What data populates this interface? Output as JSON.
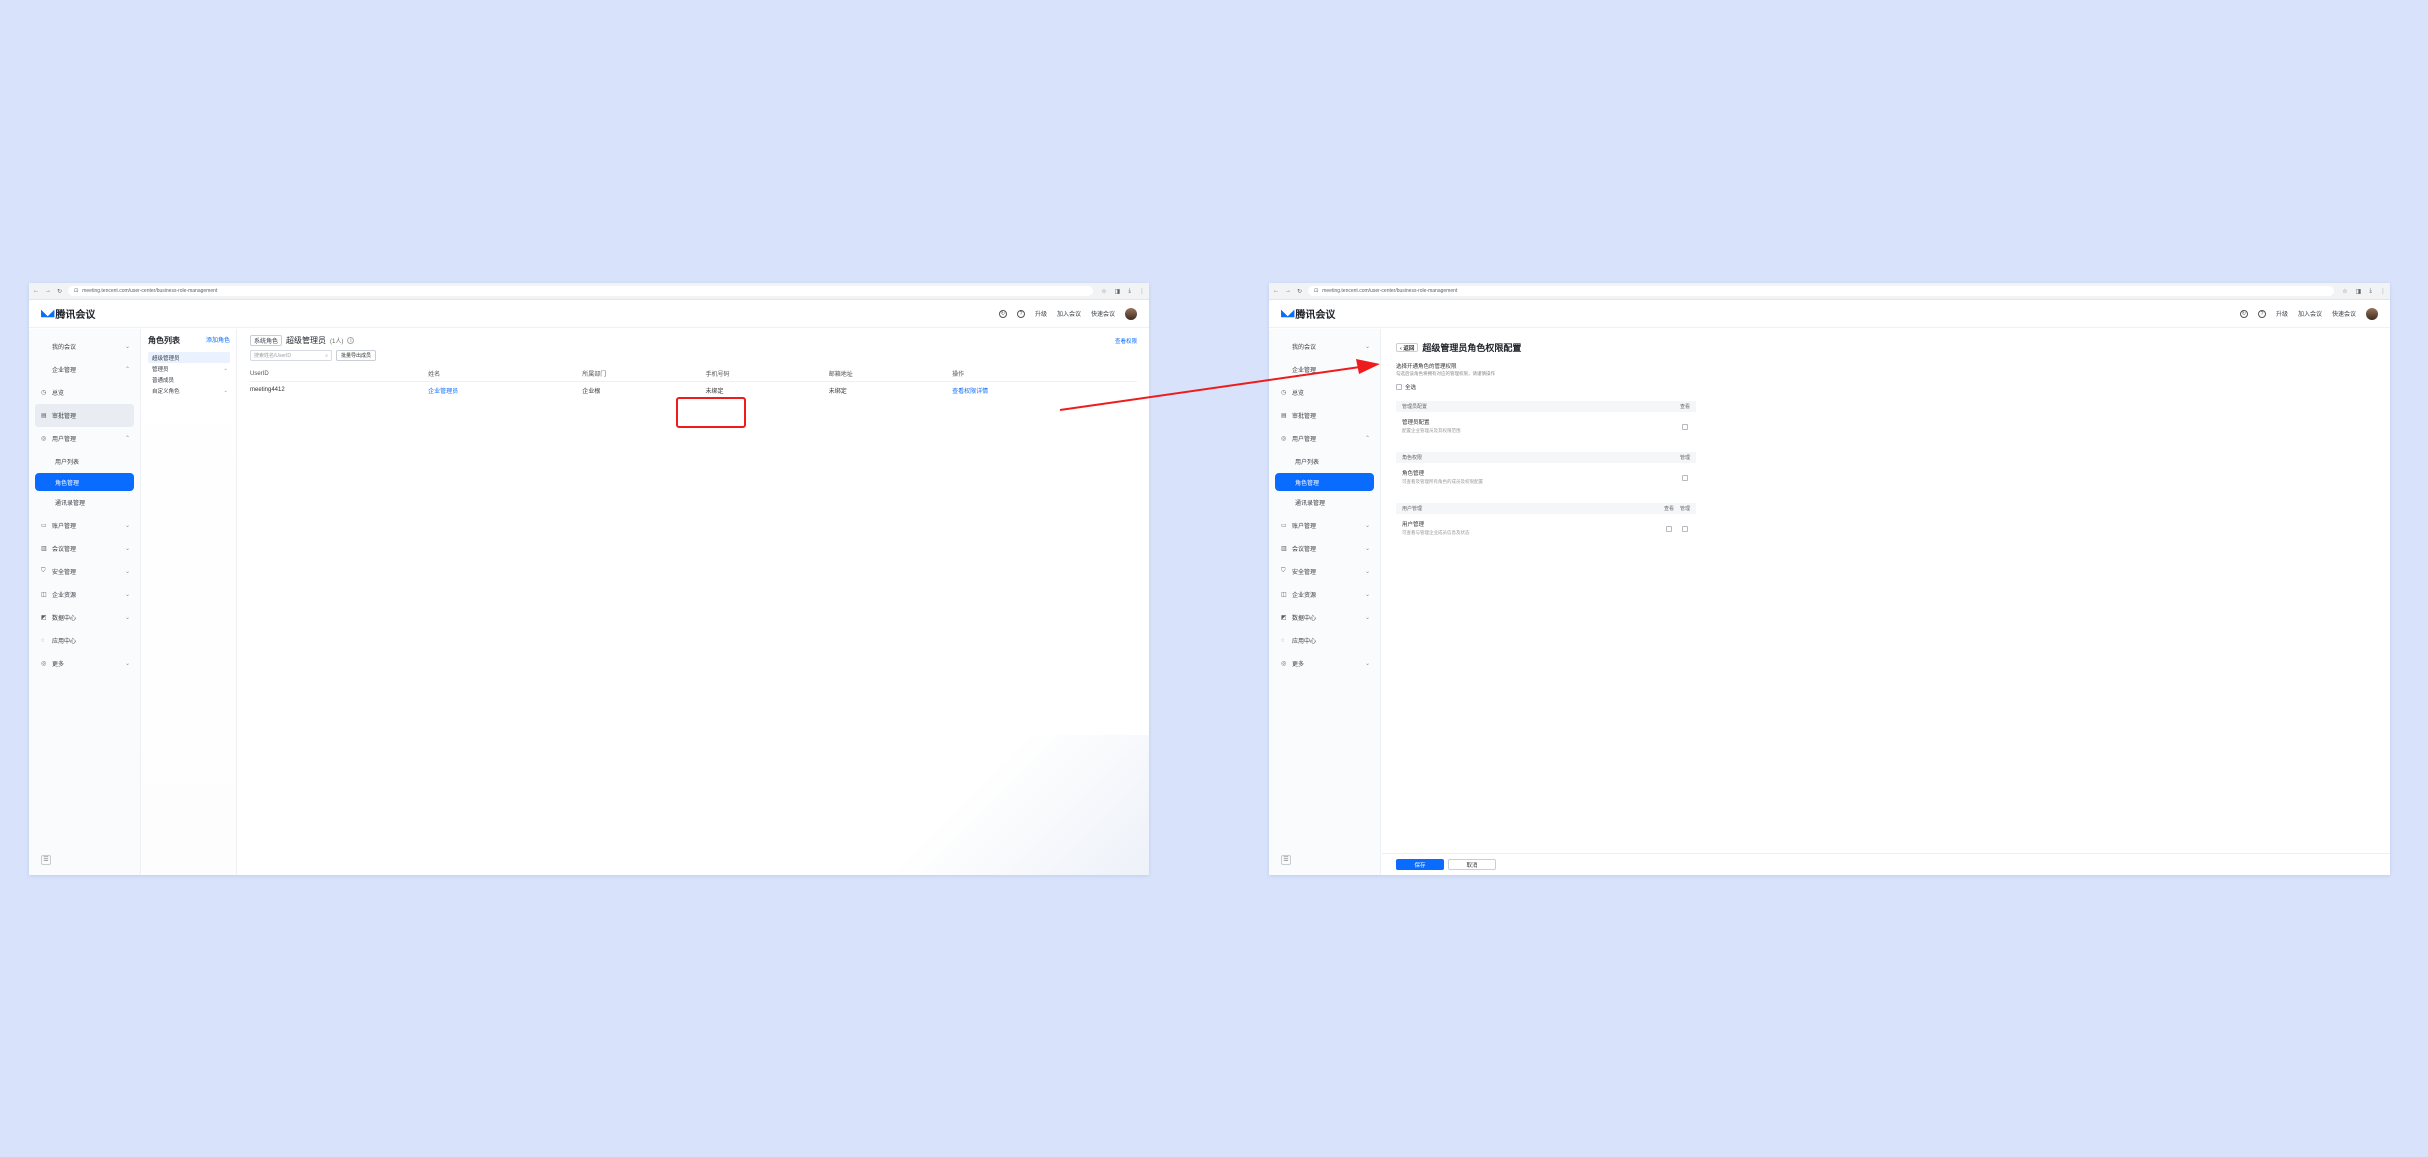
{
  "colors": {
    "accent": "#0a6cff",
    "annotation_red": "#ee1c1c",
    "page_bg": "#d8e3fb"
  },
  "left": {
    "browser": {
      "url": "meeting.tencent.com/user-center/business-role-management",
      "nav_icons": [
        "back-icon",
        "forward-icon",
        "reload-icon"
      ]
    },
    "app": {
      "logo_text": "腾讯会议",
      "header_links": [
        "升级",
        "加入会议",
        "快速会议"
      ]
    },
    "sidebar": {
      "items": [
        {
          "label": "我的会议",
          "chevron": "⌄",
          "icon": ""
        },
        {
          "label": "企业管理",
          "chevron": "⌃",
          "icon": ""
        },
        {
          "label": "总览",
          "icon": "◷",
          "chevron": ""
        },
        {
          "label": "审批管理",
          "icon": "▤",
          "chevron": ""
        },
        {
          "label": "用户管理",
          "icon": "◎",
          "chevron": "⌃"
        },
        {
          "label": "用户列表",
          "sub": true,
          "icon": "",
          "chevron": ""
        },
        {
          "label": "角色管理",
          "active": true,
          "icon": "",
          "chevron": ""
        },
        {
          "label": "通讯录管理",
          "sub": true,
          "icon": "",
          "chevron": ""
        },
        {
          "label": "账户管理",
          "icon": "▭",
          "chevron": "⌄"
        },
        {
          "label": "会议管理",
          "icon": "▥",
          "chevron": "⌄"
        },
        {
          "label": "安全管理",
          "icon": "⛉",
          "chevron": "⌄"
        },
        {
          "label": "企业资源",
          "icon": "◫",
          "chevron": "⌄"
        },
        {
          "label": "数据中心",
          "icon": "◩",
          "chevron": "⌄"
        },
        {
          "label": "应用中心",
          "icon": "◌",
          "chevron": ""
        },
        {
          "label": "更多",
          "icon": "◎",
          "chevron": "⌄"
        }
      ]
    },
    "roles": {
      "title": "角色列表",
      "add_label": "添加角色",
      "items": [
        {
          "label": "超级管理员",
          "selected": true,
          "chevron": ""
        },
        {
          "label": "管理员",
          "chevron": "⌄"
        },
        {
          "label": "普通成员",
          "chevron": ""
        },
        {
          "label": "自定义角色",
          "chevron": "⌄"
        }
      ]
    },
    "main": {
      "tag": "系统角色",
      "role_name": "超级管理员",
      "count": "(1人)",
      "info_icon": "i",
      "top_link": "查看权限",
      "search_placeholder": "搜索姓名/UserID",
      "filter_button": "批量导出成员",
      "columns": [
        "UserID",
        "姓名",
        "所属部门",
        "手机号码",
        "邮箱地址",
        "操作"
      ],
      "rows": [
        {
          "userid": "meeting4412",
          "name": "企业管理员",
          "dept": "企业根",
          "phone": "未绑定",
          "email": "未绑定",
          "action": "查看权限详情"
        }
      ]
    }
  },
  "right": {
    "browser": {
      "url": "meeting.tencent.com/user-center/business-role-management"
    },
    "app": {
      "logo_text": "腾讯会议",
      "header_links": [
        "升级",
        "加入会议",
        "快速会议"
      ]
    },
    "sidebar": {
      "items": [
        {
          "label": "我的会议",
          "chevron": "⌄",
          "icon": ""
        },
        {
          "label": "企业管理",
          "chevron": "⌃",
          "icon": ""
        },
        {
          "label": "总览",
          "icon": "◷",
          "chevron": ""
        },
        {
          "label": "审批管理",
          "icon": "▤",
          "chevron": ""
        },
        {
          "label": "用户管理",
          "icon": "◎",
          "chevron": "⌃"
        },
        {
          "label": "用户列表",
          "sub": true,
          "icon": "",
          "chevron": ""
        },
        {
          "label": "角色管理",
          "active": true,
          "icon": "",
          "chevron": ""
        },
        {
          "label": "通讯录管理",
          "sub": true,
          "icon": "",
          "chevron": ""
        },
        {
          "label": "账户管理",
          "icon": "▭",
          "chevron": "⌄"
        },
        {
          "label": "会议管理",
          "icon": "▥",
          "chevron": "⌄"
        },
        {
          "label": "安全管理",
          "icon": "⛉",
          "chevron": "⌄"
        },
        {
          "label": "企业资源",
          "icon": "◫",
          "chevron": "⌄"
        },
        {
          "label": "数据中心",
          "icon": "◩",
          "chevron": "⌄"
        },
        {
          "label": "应用中心",
          "icon": "◌",
          "chevron": ""
        },
        {
          "label": "更多",
          "icon": "◎",
          "chevron": "⌄"
        }
      ]
    },
    "edit": {
      "back_label": "‹ 返回",
      "title": "超级管理员角色权限配置",
      "hint": "选择开通角色的管理权限",
      "hint_sub": "勾选后该角色将拥有对应的管理权限，请谨慎操作",
      "select_all": "全选",
      "sections": [
        {
          "header": "管理员配置",
          "col1": "查看",
          "col2": "",
          "title": "管理员配置",
          "desc": "配置企业管理员及其权限范围",
          "two_cols": false
        },
        {
          "header": "角色权限",
          "col1": "管理",
          "col2": "",
          "title": "角色管理",
          "desc": "可查看及管理所有角色的成员及权限配置",
          "two_cols": false
        },
        {
          "header": "用户管理",
          "col1": "查看",
          "col2": "管理",
          "title": "用户管理",
          "desc": "可查看与管理企业成员信息及状态",
          "two_cols": true
        }
      ],
      "save": "保存",
      "cancel": "取消"
    }
  }
}
